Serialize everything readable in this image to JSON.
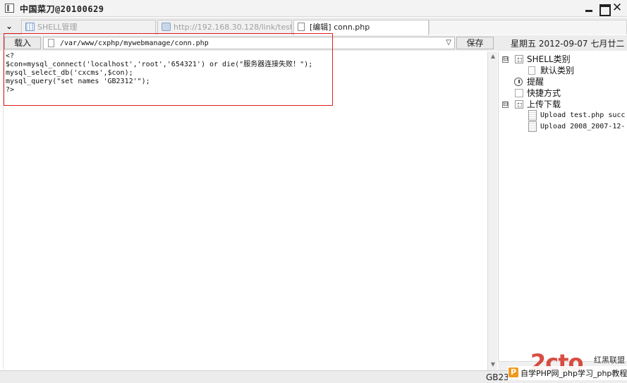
{
  "window": {
    "title": "中国菜刀@20100629",
    "close_glyph": "✕"
  },
  "tabs": [
    {
      "label": "SHELL管理",
      "icon": "grid-icon",
      "active": false
    },
    {
      "label": "http://192.168.30.128/link/test...",
      "icon": "folder-icon",
      "active": false
    },
    {
      "label": "[编辑] conn.php",
      "icon": "file-icon",
      "active": true
    }
  ],
  "toolbar": {
    "load_label": "载入",
    "path_value": "/var/www/cxphp/mywebmanage/conn.php",
    "save_label": "保存",
    "date_text": "星期五 2012-09-07 七月廿二"
  },
  "editor": {
    "lines": [
      "<?",
      "$con=mysql_connect('localhost','root','654321') or die(\"服务器连接失败！\");",
      "mysql_select_db('cxcms',$con);",
      "mysql_query(\"set names 'GB2312'\");",
      "?>"
    ]
  },
  "tree": {
    "items": [
      {
        "label": "SHELL类别",
        "expander": "⊟",
        "icon": "shell-icon"
      },
      {
        "label": "默认类别",
        "icon": "category-icon"
      },
      {
        "label": "提醒",
        "icon": "clock-icon"
      },
      {
        "label": "快捷方式",
        "icon": "shortcut-icon"
      },
      {
        "label": "上传下载",
        "expander": "⊟",
        "icon": "shell-icon"
      },
      {
        "label": "Upload test.php succ",
        "icon": "document-icon"
      },
      {
        "label": "Upload 2008_2007-12-",
        "icon": "document-icon"
      }
    ]
  },
  "status": {
    "encoding": "GB2312"
  },
  "watermark": {
    "logo_text": "2cto",
    "logo_sub": "红黑联盟",
    "badge": "P",
    "text": "自学PHP网_php学习_php教程"
  },
  "colors": {
    "highlight_border": "#e0201e",
    "watermark_red": "#d43a2e",
    "badge_orange": "#f29a1c"
  }
}
